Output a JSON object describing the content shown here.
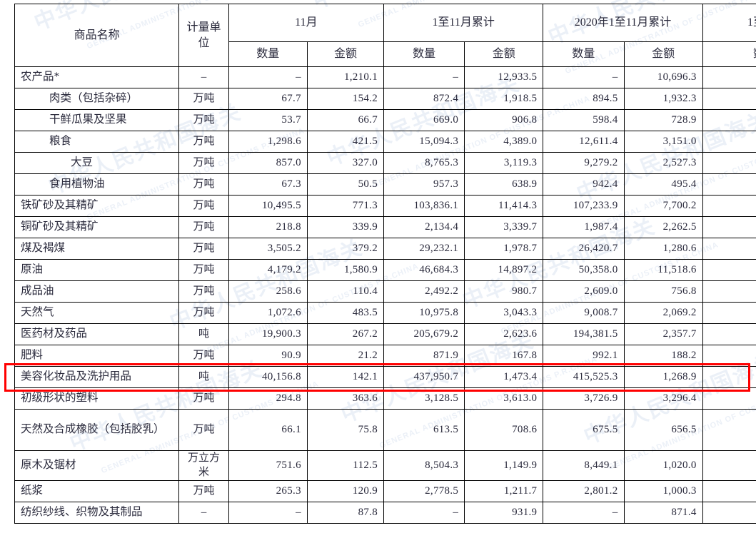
{
  "watermark": {
    "cn": "中华人民共和国海关",
    "en": "GENERAL ADMINISTRATION OF CUSTOMS P.R.CHINA"
  },
  "highlight": {
    "color": "#ff0000",
    "row_label": "美容化妆品及洗护用品"
  },
  "table": {
    "header": {
      "name": "商品名称",
      "unit": "计量单位",
      "groups": [
        {
          "label": "11月"
        },
        {
          "label": "1至11月累计"
        },
        {
          "label": "2020年1至11月累计"
        },
        {
          "label": "1至"
        }
      ],
      "sub": {
        "qty": "数量",
        "amount": "金额",
        "qty_cut": "数"
      }
    },
    "rows": [
      {
        "name": "农产品*",
        "indent": 0,
        "unit": "–",
        "nov_qty": "–",
        "nov_amt": "1,210.1",
        "cum_qty": "–",
        "cum_amt": "12,933.5",
        "py_qty": "–",
        "py_amt": "10,696.3"
      },
      {
        "name": "肉类（包括杂碎）",
        "indent": 1,
        "unit": "万吨",
        "nov_qty": "67.7",
        "nov_amt": "154.2",
        "cum_qty": "872.4",
        "cum_amt": "1,918.5",
        "py_qty": "894.5",
        "py_amt": "1,932.3"
      },
      {
        "name": "干鲜瓜果及坚果",
        "indent": 1,
        "unit": "万吨",
        "nov_qty": "53.7",
        "nov_amt": "66.7",
        "cum_qty": "669.0",
        "cum_amt": "906.8",
        "py_qty": "598.4",
        "py_amt": "728.9"
      },
      {
        "name": "粮食",
        "indent": 1,
        "unit": "万吨",
        "nov_qty": "1,298.6",
        "nov_amt": "421.5",
        "cum_qty": "15,094.3",
        "cum_amt": "4,389.0",
        "py_qty": "12,611.4",
        "py_amt": "3,151.0"
      },
      {
        "name": "大豆",
        "indent": 2,
        "unit": "万吨",
        "nov_qty": "857.0",
        "nov_amt": "327.0",
        "cum_qty": "8,765.3",
        "cum_amt": "3,119.3",
        "py_qty": "9,279.2",
        "py_amt": "2,527.3"
      },
      {
        "name": "食用植物油",
        "indent": 1,
        "unit": "万吨",
        "nov_qty": "67.3",
        "nov_amt": "50.5",
        "cum_qty": "957.3",
        "cum_amt": "638.9",
        "py_qty": "942.4",
        "py_amt": "495.4"
      },
      {
        "name": "铁矿砂及其精矿",
        "indent": 0,
        "unit": "万吨",
        "nov_qty": "10,495.5",
        "nov_amt": "771.3",
        "cum_qty": "103,836.1",
        "cum_amt": "11,414.3",
        "py_qty": "107,233.9",
        "py_amt": "7,700.2"
      },
      {
        "name": "铜矿砂及其精矿",
        "indent": 0,
        "unit": "万吨",
        "nov_qty": "218.8",
        "nov_amt": "339.9",
        "cum_qty": "2,134.4",
        "cum_amt": "3,339.7",
        "py_qty": "1,987.4",
        "py_amt": "2,262.5"
      },
      {
        "name": "煤及褐煤",
        "indent": 0,
        "unit": "万吨",
        "nov_qty": "3,505.2",
        "nov_amt": "379.2",
        "cum_qty": "29,232.1",
        "cum_amt": "1,978.7",
        "py_qty": "26,420.7",
        "py_amt": "1,280.6"
      },
      {
        "name": "原油",
        "indent": 0,
        "unit": "万吨",
        "nov_qty": "4,179.2",
        "nov_amt": "1,580.9",
        "cum_qty": "46,684.3",
        "cum_amt": "14,897.2",
        "py_qty": "50,358.0",
        "py_amt": "11,518.6"
      },
      {
        "name": "成品油",
        "indent": 0,
        "unit": "万吨",
        "nov_qty": "258.6",
        "nov_amt": "110.4",
        "cum_qty": "2,492.2",
        "cum_amt": "980.7",
        "py_qty": "2,609.0",
        "py_amt": "756.8"
      },
      {
        "name": "天然气",
        "indent": 0,
        "unit": "万吨",
        "nov_qty": "1,072.6",
        "nov_amt": "483.5",
        "cum_qty": "10,975.8",
        "cum_amt": "3,043.3",
        "py_qty": "9,008.7",
        "py_amt": "2,069.2"
      },
      {
        "name": "医药材及药品",
        "indent": 0,
        "unit": "吨",
        "nov_qty": "19,900.3",
        "nov_amt": "267.2",
        "cum_qty": "205,679.2",
        "cum_amt": "2,623.6",
        "py_qty": "194,381.5",
        "py_amt": "2,357.7"
      },
      {
        "name": "肥料",
        "indent": 0,
        "unit": "万吨",
        "nov_qty": "90.9",
        "nov_amt": "21.2",
        "cum_qty": "871.9",
        "cum_amt": "167.8",
        "py_qty": "992.1",
        "py_amt": "188.2"
      },
      {
        "name": "美容化妆品及洗护用品",
        "indent": 0,
        "unit": "吨",
        "nov_qty": "40,156.8",
        "nov_amt": "142.1",
        "cum_qty": "437,950.7",
        "cum_amt": "1,473.4",
        "py_qty": "415,525.3",
        "py_amt": "1,268.9",
        "highlighted": true
      },
      {
        "name": "初级形状的塑料",
        "indent": 0,
        "unit": "万吨",
        "nov_qty": "294.8",
        "nov_amt": "363.6",
        "cum_qty": "3,128.5",
        "cum_amt": "3,613.0",
        "py_qty": "3,726.9",
        "py_amt": "3,296.4"
      },
      {
        "name": "天然及合成橡胶（包括胶乳）",
        "indent": 0,
        "unit": "万吨",
        "nov_qty": "66.1",
        "nov_amt": "75.8",
        "cum_qty": "613.5",
        "cum_amt": "708.6",
        "py_qty": "675.5",
        "py_amt": "656.5",
        "tall": true
      },
      {
        "name": "原木及锯材",
        "indent": 0,
        "unit": "万立方米",
        "nov_qty": "751.6",
        "nov_amt": "112.5",
        "cum_qty": "8,504.3",
        "cum_amt": "1,149.9",
        "py_qty": "8,449.1",
        "py_amt": "1,020.0"
      },
      {
        "name": "纸浆",
        "indent": 0,
        "unit": "万吨",
        "nov_qty": "265.3",
        "nov_amt": "120.9",
        "cum_qty": "2,778.5",
        "cum_amt": "1,211.7",
        "py_qty": "2,801.2",
        "py_amt": "1,000.3"
      },
      {
        "name": "纺织纱线、织物及其制品",
        "indent": 0,
        "unit": "–",
        "nov_qty": "–",
        "nov_amt": "87.8",
        "cum_qty": "–",
        "cum_amt": "931.9",
        "py_qty": "–",
        "py_amt": "871.4"
      }
    ]
  }
}
